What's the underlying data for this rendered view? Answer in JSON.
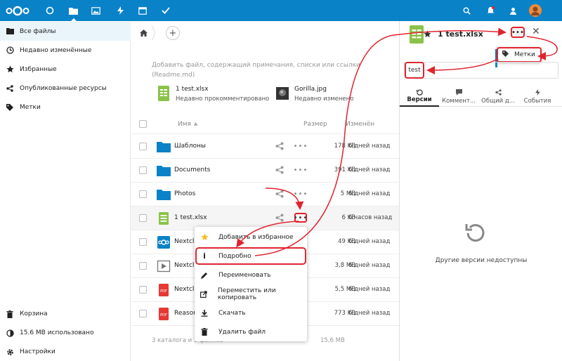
{
  "topbar": {
    "apps": [
      "logo-icon",
      "dashboard-icon",
      "files-icon",
      "photos-icon",
      "activity-icon",
      "calendar-icon",
      "tasks-icon"
    ],
    "right": [
      "search-icon",
      "notifications-icon",
      "contacts-icon",
      "avatar"
    ]
  },
  "sidebar": {
    "items": [
      {
        "label": "Все файлы",
        "icon": "folder-icon"
      },
      {
        "label": "Недавно изменённые",
        "icon": "clock-icon"
      },
      {
        "label": "Избранные",
        "icon": "star-icon"
      },
      {
        "label": "Опубликованные ресурсы",
        "icon": "share-icon"
      },
      {
        "label": "Метки",
        "icon": "tag-icon"
      }
    ],
    "bottom": [
      {
        "label": "Корзина",
        "icon": "trash-icon"
      },
      {
        "label": "15.6 MB использовано",
        "icon": "quota-icon"
      },
      {
        "label": "Настройки",
        "icon": "settings-icon"
      }
    ]
  },
  "main": {
    "readme_placeholder": "Добавить файл, содержащий примечания, списки или ссылки (Readme.md)",
    "recent": [
      {
        "name": "1 test.xlsx",
        "sub": "Недавно прокомментировано"
      },
      {
        "name": "Gorilla.jpg",
        "sub": "Недавно изменено"
      }
    ],
    "columns": {
      "name": "Имя",
      "size": "Размер",
      "modified": "Изменён"
    },
    "files": [
      {
        "name": "Шаблоны",
        "size": "178 KB",
        "date": "6 дней назад",
        "type": "folder"
      },
      {
        "name": "Documents",
        "size": "391 KB",
        "date": "6 дней назад",
        "type": "folder"
      },
      {
        "name": "Photos",
        "size": "5 MB",
        "date": "6 дней назад",
        "type": "folder"
      },
      {
        "name": "1 test.xlsx",
        "size": "6 KB",
        "date": "6 часов назад",
        "type": "xlsx"
      },
      {
        "name": "Nextclo",
        "size": "49 KB",
        "date": "6 дней назад",
        "type": "nextcloud"
      },
      {
        "name": "Nextclo",
        "size": "3,8 MB",
        "date": "6 дней назад",
        "type": "video"
      },
      {
        "name": "Nextclo",
        "size": "5,5 MB",
        "date": "6 дней назад",
        "type": "pdf"
      },
      {
        "name": "Reasor",
        "size": "773 KB",
        "date": "6 дней назад",
        "type": "pdf"
      }
    ],
    "summary": "3 каталога и 5 файлов",
    "summary_size": "15,6 MB"
  },
  "context_menu": {
    "items": [
      {
        "label": "Добавить в избранное",
        "icon": "star-icon"
      },
      {
        "label": "Подробно",
        "icon": "info-icon"
      },
      {
        "label": "Переименовать",
        "icon": "pencil-icon"
      },
      {
        "label": "Переместить или копировать",
        "icon": "move-icon"
      },
      {
        "label": "Скачать",
        "icon": "download-icon"
      },
      {
        "label": "Удалить файл",
        "icon": "trash-icon"
      }
    ]
  },
  "details": {
    "title": "1 test.xlsx",
    "tags_menu_label": "Метки",
    "tag_value": "test",
    "tabs": [
      {
        "label": "Версии",
        "icon": "history-icon"
      },
      {
        "label": "Коммент...",
        "icon": "comment-icon"
      },
      {
        "label": "Общий д...",
        "icon": "share-icon"
      },
      {
        "label": "События",
        "icon": "activity-icon"
      }
    ],
    "empty_text": "Другие версии недоступны"
  },
  "colors": {
    "brand": "#0a82c8",
    "annotation": "#e0242e",
    "xlsx": "#8bc34a",
    "pdf": "#e53935"
  }
}
